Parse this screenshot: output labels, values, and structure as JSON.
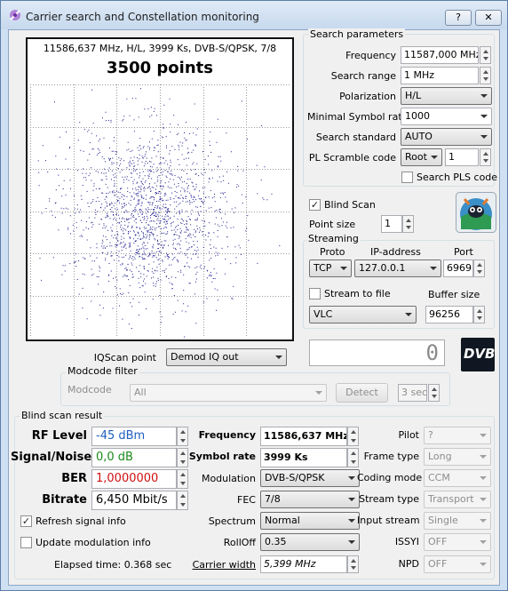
{
  "window": {
    "title": "Carrier search and Constellation monitoring",
    "help_label": "?",
    "close_label": "✕"
  },
  "constellation": {
    "info": "11586,637 MHz, H/L, 3999 Ks, DVB-S/QPSK, 7/8",
    "points_label": "3500 points",
    "point_count": 3500,
    "dot_color": "#1a1a8c"
  },
  "search_params": {
    "group_title": "Search parameters",
    "frequency_label": "Frequency",
    "frequency_value": "11587,000 MHz",
    "search_range_label": "Search range",
    "search_range_value": "1 MHz",
    "polarization_label": "Polarization",
    "polarization_value": "H/L",
    "min_symbol_rate_label": "Minimal Symbol rate",
    "min_symbol_rate_value": "1000",
    "search_standard_label": "Search standard",
    "search_standard_value": "AUTO",
    "pl_scramble_label": "PL Scramble code",
    "pl_scramble_mode": "Root",
    "pl_scramble_value": "1",
    "search_pls_label": "Search PLS code",
    "search_pls_checked": false
  },
  "blind": {
    "blind_scan_label": "Blind Scan",
    "blind_scan_checked": true,
    "point_size_label": "Point size",
    "point_size_value": "1"
  },
  "streaming": {
    "group_title": "Streaming",
    "proto_label": "Proto",
    "ip_label": "IP-address",
    "port_label": "Port",
    "proto_value": "TCP",
    "ip_value": "127.0.0.1",
    "port_value": "6969",
    "stream_to_file_label": "Stream to file",
    "stream_to_file_checked": false,
    "buffer_size_label": "Buffer size",
    "player_value": "VLC",
    "buffer_size_value": "96256"
  },
  "iq": {
    "iqscan_label": "IQScan point",
    "iqscan_value": "Demod IQ out",
    "counter_value": "0",
    "dvb_logo": "DVB"
  },
  "modcode": {
    "group_title": "Modcode filter",
    "label": "Modcode",
    "value": "All",
    "detect_label": "Detect",
    "interval_value": "3 sec"
  },
  "result": {
    "group_title": "Blind scan result",
    "rf_level_label": "RF Level",
    "rf_level_value": "-45 dBm",
    "rf_level_color": "#1f5fbf",
    "snr_label": "Signal/Noise",
    "snr_value": "0,0 dB",
    "snr_color": "#1a8a1a",
    "ber_label": "BER",
    "ber_value": "1,0000000",
    "ber_color": "#d01010",
    "bitrate_label": "Bitrate",
    "bitrate_value": "6,450 Mbit/s",
    "refresh_label": "Refresh signal info",
    "refresh_checked": true,
    "update_mod_label": "Update modulation info",
    "update_mod_checked": false,
    "elapsed_label": "Elapsed time: 0.368 sec",
    "frequency_label": "Frequency",
    "frequency_value": "11586,637 MHz",
    "symbol_rate_label": "Symbol rate",
    "symbol_rate_value": "3999 Ks",
    "modulation_label": "Modulation",
    "modulation_value": "DVB-S/QPSK",
    "fec_label": "FEC",
    "fec_value": "7/8",
    "spectrum_label": "Spectrum",
    "spectrum_value": "Normal",
    "rolloff_label": "RollOff",
    "rolloff_value": "0.35",
    "carrier_width_label": "Carrier width",
    "carrier_width_value": "5,399 MHz",
    "pilot_label": "Pilot",
    "pilot_value": "?",
    "frame_type_label": "Frame type",
    "frame_type_value": "Long",
    "coding_mode_label": "Coding mode",
    "coding_mode_value": "CCM",
    "stream_type_label": "Stream type",
    "stream_type_value": "Transport",
    "input_stream_label": "Input stream",
    "input_stream_value": "Single",
    "issyi_label": "ISSYI",
    "issyi_value": "OFF",
    "npd_label": "NPD",
    "npd_value": "OFF"
  }
}
